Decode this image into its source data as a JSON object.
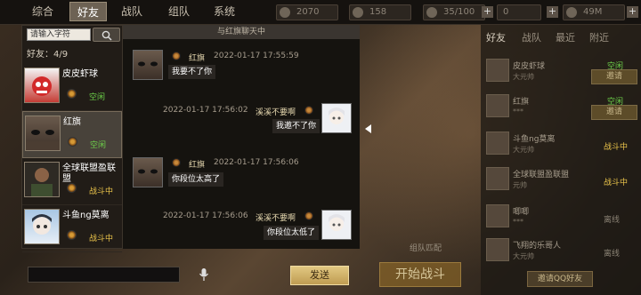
{
  "top_tabs": [
    "综合",
    "好友",
    "战队",
    "组队",
    "系统"
  ],
  "resources": {
    "value1": "2070",
    "value2": "158",
    "value3": "35/100",
    "value4": "49M"
  },
  "search": {
    "placeholder": "请输入字符",
    "icon": "search-icon"
  },
  "friend_count": "好友：4/9",
  "friends": [
    {
      "name": "皮皮虾球",
      "status": "空闲"
    },
    {
      "name": "红旗",
      "status": "空闲"
    },
    {
      "name": "全球联盟盈联盟",
      "status": "战斗中"
    },
    {
      "name": "斗鱼ng莫离",
      "status": "战斗中"
    }
  ],
  "chat": {
    "header": "与红旗聊天中",
    "messages": [
      {
        "side": "left",
        "name": "红旗",
        "time": "2022-01-17 17:55:59",
        "text": "我要不了你"
      },
      {
        "side": "right",
        "name": "溪溪不要啊",
        "time": "2022-01-17 17:56:02",
        "text": "我邀不了你"
      },
      {
        "side": "left",
        "name": "红旗",
        "time": "2022-01-17 17:56:06",
        "text": "你段位太高了"
      },
      {
        "side": "right",
        "name": "溪溪不要啊",
        "time": "2022-01-17 17:56:06",
        "text": "你段位太低了"
      }
    ]
  },
  "send_label": "发送",
  "right_tabs": [
    "好友",
    "战队",
    "最近",
    "附近"
  ],
  "right_list": [
    {
      "name": "皮皮虾球",
      "sub": "大元帅",
      "btn": "邀请",
      "status": "空闲"
    },
    {
      "name": "红旗",
      "sub": "***",
      "btn": "邀请",
      "status": "空闲"
    },
    {
      "name": "斗鱼ng莫离",
      "sub": "大元帅",
      "btn": "",
      "status": "战斗中"
    },
    {
      "name": "全球联盟盈联盟",
      "sub": "元帅",
      "btn": "",
      "status": "战斗中"
    },
    {
      "name": "唧唧",
      "sub": "***",
      "btn": "",
      "status": "离线"
    },
    {
      "name": "飞翔的乐哥人",
      "sub": "大元帅",
      "btn": "",
      "status": "离线"
    }
  ],
  "mid": {
    "start": "开始战斗",
    "match": "组队匹配",
    "invite_text": "邀请QQ好友"
  }
}
